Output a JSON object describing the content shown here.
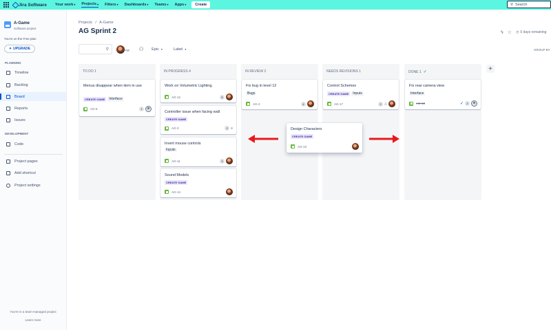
{
  "topbar": {
    "product": "Jira Software",
    "nav": [
      {
        "label": "Your work"
      },
      {
        "label": "Projects"
      },
      {
        "label": "Filters"
      },
      {
        "label": "Dashboards"
      },
      {
        "label": "Teams"
      },
      {
        "label": "Apps"
      }
    ],
    "create_label": "Create",
    "search_placeholder": "Search"
  },
  "sidebar": {
    "project_name": "A-Game",
    "project_type": "Software project",
    "plan_note": "You're on the Free plan",
    "upgrade_label": "UPGRADE",
    "planning_label": "PLANNING",
    "development_label": "DEVELOPMENT",
    "items": [
      {
        "label": "Timeline"
      },
      {
        "label": "Backlog"
      },
      {
        "label": "Board"
      },
      {
        "label": "Reports"
      },
      {
        "label": "Issues"
      },
      {
        "label": "Code"
      },
      {
        "label": "Project pages"
      },
      {
        "label": "Add shortcut"
      },
      {
        "label": "Project settings"
      }
    ],
    "footer_text": "You're in a team-managed project",
    "learn_more": "Learn more"
  },
  "main": {
    "breadcrumb": [
      "Projects",
      "/",
      "A-Game"
    ],
    "title": "AG Sprint 2",
    "days_remaining": "0 days remaining",
    "filter_epic": "Epic",
    "filter_label": "Label",
    "group_by": "GROUP BY",
    "avatar_label": "Reggi"
  },
  "columns": [
    {
      "title": "TO DO 1",
      "cards": [
        {
          "title": "Menus disappear when item in use",
          "lozenge": "CREATE GAME",
          "tag": "Interface",
          "key": "AG-5",
          "estimate": "1",
          "assignee": "none"
        }
      ]
    },
    {
      "title": "IN PROGRESS 4",
      "cards": [
        {
          "title": "Work on Volumetric Lighting.",
          "key": "AG-12",
          "estimate": "5",
          "assignee": "user"
        },
        {
          "title": "Controller issue when facing wall",
          "lozenge": "CREATE GAME",
          "key": "AG-3",
          "estimate": "2",
          "priority": "low"
        },
        {
          "title": "Invert mouse controls",
          "tag": "Inputs",
          "key": "AG-11",
          "estimate": "3",
          "assignee": "user"
        },
        {
          "title": "Sound Models",
          "lozenge": "CREATE GAME",
          "key": "AG-14",
          "assignee": "user"
        }
      ]
    },
    {
      "title": "IN REVIEW 2",
      "cards": [
        {
          "title": "Fix bug in level 12",
          "tag": "Bugs",
          "key": "AG-2",
          "estimate": "4",
          "assignee": "user"
        }
      ]
    },
    {
      "title": "NEEDS REVISIONS 1",
      "cards": [
        {
          "title": "Control Schemes",
          "lozenge": "CREATE GAME",
          "tag": "Inputs",
          "key": "AG-17",
          "estimate": "2",
          "assignee": "user"
        }
      ]
    },
    {
      "title": "DONE 1",
      "cards": [
        {
          "title": "Fix rear camera view",
          "tag": "Interface",
          "key": "AG-10",
          "estimate": "2",
          "assignee": "none"
        }
      ]
    }
  ],
  "dragging_card": {
    "title": "Design Characters",
    "lozenge": "CREATE GAME",
    "key": "AG-13",
    "assignee": "user"
  },
  "colors": {
    "topbar": "#5cf5e0",
    "accent": "#0052cc",
    "arrow": "#e8191c",
    "lozenge_bg": "#eae6ff",
    "story": "#63ba3c"
  }
}
